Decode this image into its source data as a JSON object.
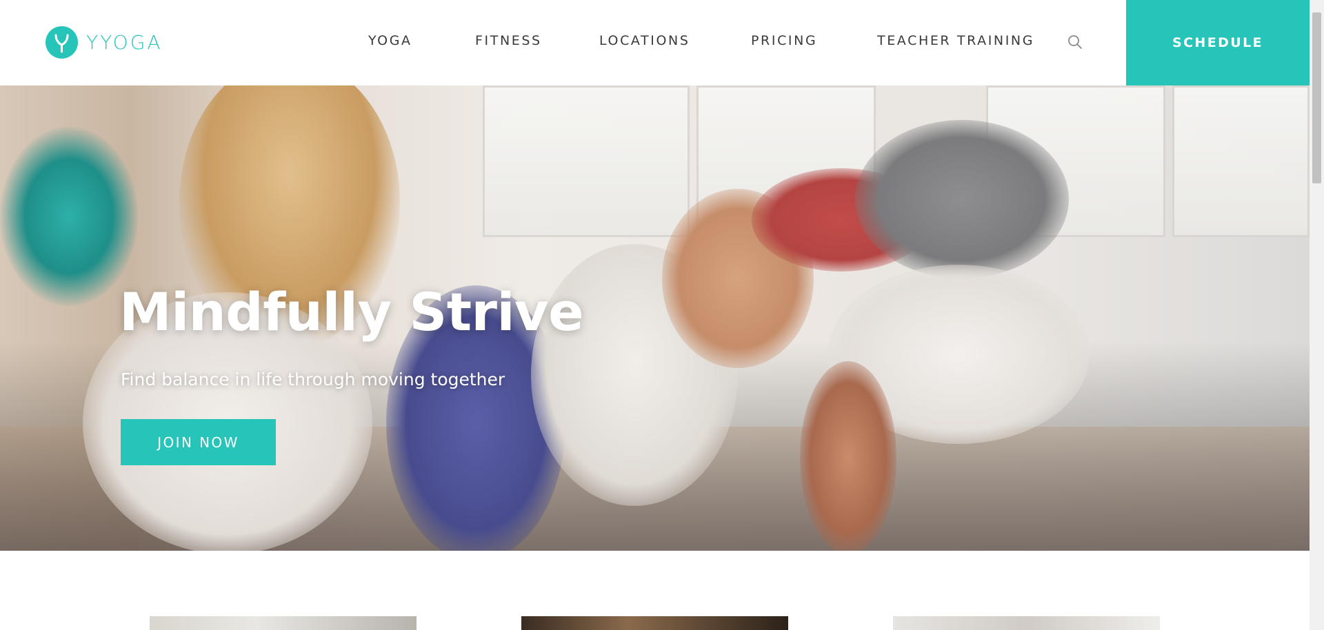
{
  "brand": {
    "name": "YYOGA",
    "accent": "#27c5b9"
  },
  "nav": {
    "items": [
      {
        "label": "YOGA"
      },
      {
        "label": "FITNESS"
      },
      {
        "label": "LOCATIONS"
      },
      {
        "label": "PRICING"
      },
      {
        "label": "TEACHER TRAINING"
      }
    ],
    "search_icon": "search-icon",
    "schedule_label": "SCHEDULE"
  },
  "hero": {
    "title": "Mindfully Strive",
    "subtitle": "Find balance in life through moving together",
    "cta_label": "JOIN NOW"
  }
}
